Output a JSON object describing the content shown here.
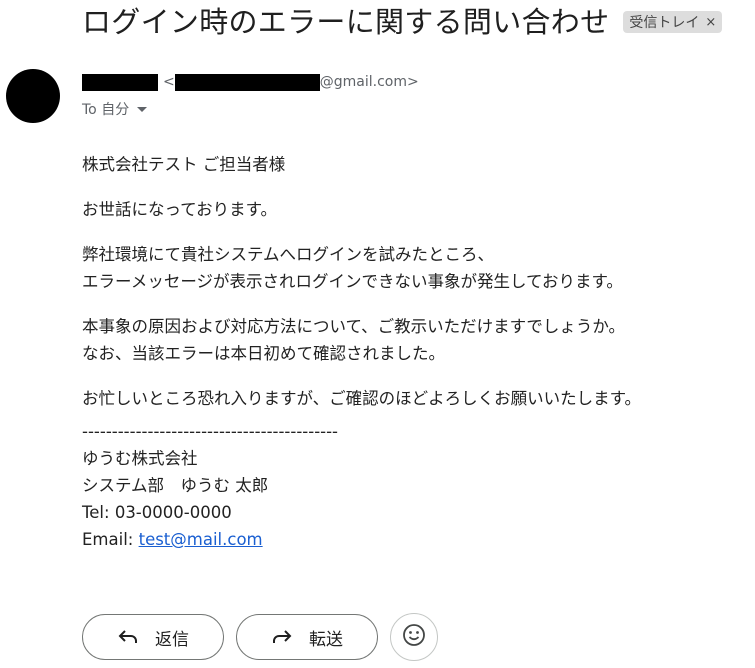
{
  "email": {
    "subject": "ログイン時のエラーに関する問い合わせ",
    "label": "受信トレイ",
    "label_close": "×",
    "sender": {
      "name": "",
      "email_open": "<",
      "email_domain": "@gmail.com>",
      "avatar_color": "#000000"
    },
    "recipient": "To 自分",
    "body_paragraphs": [
      [
        "株式会社テスト ご担当者様"
      ],
      [
        "お世話になっております。"
      ],
      [
        "弊社環境にて貴社システムへログインを試みたところ、",
        "エラーメッセージが表示されログインできない事象が発生しております。"
      ],
      [
        "本事象の原因および対応方法について、ご教示いただけますでしょうか。",
        "なお、当該エラーは本日初めて確認されました。"
      ],
      [
        "お忙しいところ恐れ入りますが、ご確認のほどよろしくお願いいたします。"
      ]
    ],
    "signature": {
      "divider": "-------------------------------------------",
      "company": "ゆうむ株式会社",
      "dept_name": "システム部　ゆうむ 太郎",
      "tel": "Tel: 03-0000-0000",
      "email_prefix": "Email: ",
      "email_link": "test@mail.com"
    }
  },
  "actions": {
    "reply_label": "返信",
    "forward_label": "転送",
    "emoji_icon": "smiley-icon"
  },
  "colors": {
    "link": "#1a5fd1",
    "label_chip_bg": "#dddddd",
    "button_border": "#747775"
  }
}
